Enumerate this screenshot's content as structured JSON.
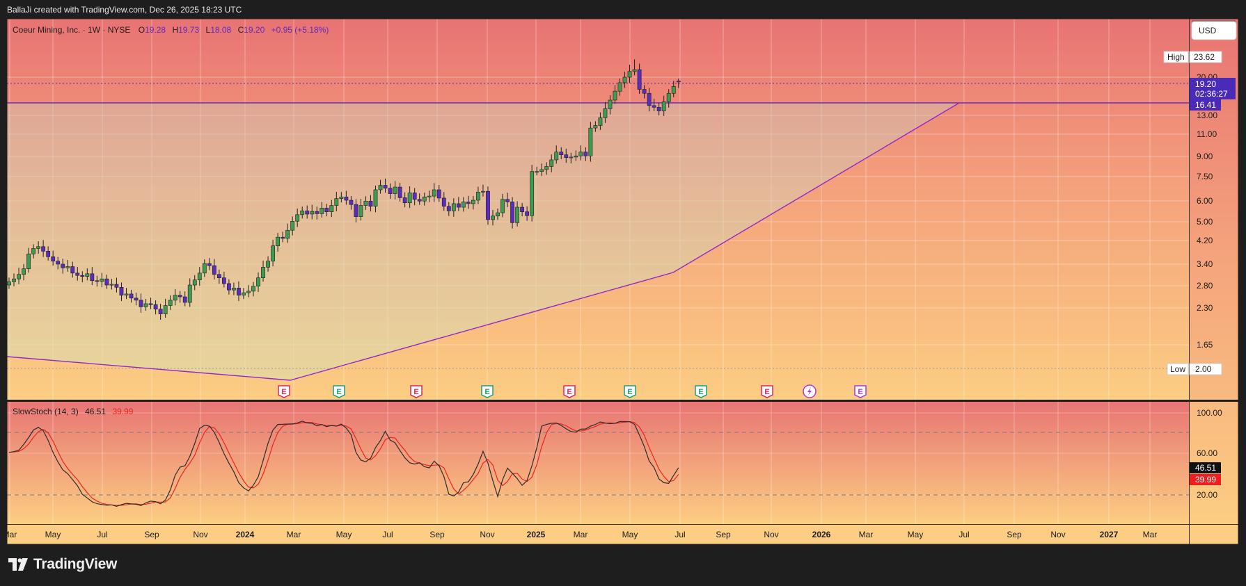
{
  "header": {
    "credit": "BallaJi created with TradingView.com, Dec 26, 2025 18:23 UTC"
  },
  "footer": {
    "brand": "TradingView"
  },
  "colors": {
    "up": "#3e9b4f",
    "down": "#5b2cc0",
    "trendline": "#8b2bc9",
    "k_line": "#2b2b2b",
    "d_line": "#e8251e",
    "bg_top": "#e87575",
    "bg_bottom": "#fcd080",
    "price_tag": "#4a2bb8"
  },
  "legend": {
    "symbol": "Coeur Mining, Inc. · 1W · NYSE",
    "o_label": "O",
    "o_val": "19.28",
    "h_label": "H",
    "h_val": "19.73",
    "l_label": "L",
    "l_val": "18.08",
    "c_label": "C",
    "c_val": "19.20",
    "change": "+0.95 (+5.18%)"
  },
  "currency": "USD",
  "markers": {
    "high_label": "High",
    "high_val": "23.62",
    "low_label": "Low",
    "low_val": "2.00",
    "last_price": "19.20",
    "countdown": "02:36:27",
    "hline_price": "16.41"
  },
  "stoch": {
    "title": "SlowStoch (14, 3)",
    "k_val": "46.51",
    "d_val": "39.99"
  },
  "chart_data": {
    "type": "candlestick",
    "timeframe": "1W",
    "y_scale": "log",
    "price_ticks": [
      "20.00",
      "13.00",
      "11.00",
      "9.00",
      "7.50",
      "6.00",
      "5.00",
      "4.20",
      "3.40",
      "2.80",
      "2.30",
      "1.65"
    ],
    "stoch_ticks": [
      "100.00",
      "60.00",
      "20.00"
    ],
    "x_ticks": [
      "Mar",
      "May",
      "Jul",
      "Sep",
      "Nov",
      "2024",
      "Mar",
      "May",
      "Jul",
      "Sep",
      "Nov",
      "2025",
      "Mar",
      "May",
      "Jul",
      "Sep",
      "Nov",
      "2026",
      "Mar",
      "May",
      "Jul",
      "Sep",
      "Nov",
      "2027",
      "Mar"
    ],
    "horizontal_line": 16.41,
    "trendline": [
      {
        "date": "2023-02-20",
        "price": 2.0
      },
      {
        "date": "2024-02-19",
        "price": 1.85
      },
      {
        "date": "2025-06-30",
        "price": 4.3
      },
      {
        "date": "2026-06-20",
        "price": 16.41
      }
    ],
    "earnings_markers": [
      {
        "date": "2024-02-19",
        "type": "E",
        "color": "red"
      },
      {
        "date": "2024-05-06",
        "type": "E",
        "color": "green"
      },
      {
        "date": "2024-08-05",
        "type": "E",
        "color": "red"
      },
      {
        "date": "2024-11-04",
        "type": "E",
        "color": "green"
      },
      {
        "date": "2025-02-17",
        "type": "E",
        "color": "red"
      },
      {
        "date": "2025-05-05",
        "type": "E",
        "color": "green"
      },
      {
        "date": "2025-08-04",
        "type": "E",
        "color": "green"
      },
      {
        "date": "2025-10-27",
        "type": "E",
        "color": "red"
      },
      {
        "date": "2025-12-26",
        "type": "dividend",
        "color": "purple"
      },
      {
        "date": "2026-02-16",
        "type": "E",
        "color": "purple"
      }
    ],
    "closes": [
      2.97,
      3.05,
      3.18,
      3.35,
      3.85,
      4.05,
      4.12,
      3.95,
      3.75,
      3.6,
      3.5,
      3.38,
      3.42,
      3.22,
      3.15,
      3.12,
      3.2,
      3.0,
      2.98,
      3.05,
      2.88,
      2.9,
      2.82,
      2.62,
      2.65,
      2.55,
      2.5,
      2.35,
      2.42,
      2.4,
      2.3,
      2.2,
      2.38,
      2.5,
      2.62,
      2.58,
      2.45,
      2.88,
      3.02,
      3.22,
      3.52,
      3.45,
      3.18,
      3.08,
      2.92,
      2.75,
      2.8,
      2.62,
      2.68,
      2.72,
      2.85,
      3.08,
      3.4,
      3.6,
      4.15,
      4.5,
      4.45,
      4.8,
      5.22,
      5.55,
      5.75,
      5.58,
      5.72,
      5.6,
      5.9,
      5.7,
      6.05,
      6.45,
      6.55,
      6.35,
      6.1,
      5.45,
      6.05,
      6.3,
      6.0,
      7.0,
      7.3,
      7.1,
      6.75,
      7.18,
      6.5,
      6.2,
      6.8,
      6.4,
      6.3,
      6.55,
      6.6,
      7.0,
      6.48,
      6.0,
      5.75,
      6.15,
      5.95,
      6.25,
      6.15,
      6.35,
      6.85,
      6.9,
      5.3,
      5.48,
      5.65,
      6.4,
      6.25,
      5.15,
      5.95,
      5.7,
      5.5,
      8.3,
      8.3,
      8.45,
      8.7,
      9.25,
      9.95,
      9.7,
      9.45,
      9.5,
      9.6,
      9.95,
      9.6,
      12.45,
      12.75,
      13.7,
      14.9,
      16.15,
      17.55,
      19.0,
      20.0,
      21.1,
      21.45,
      17.85,
      17.2,
      15.35,
      15.1,
      14.6,
      15.9,
      17.2,
      18.35,
      19.2
    ]
  }
}
